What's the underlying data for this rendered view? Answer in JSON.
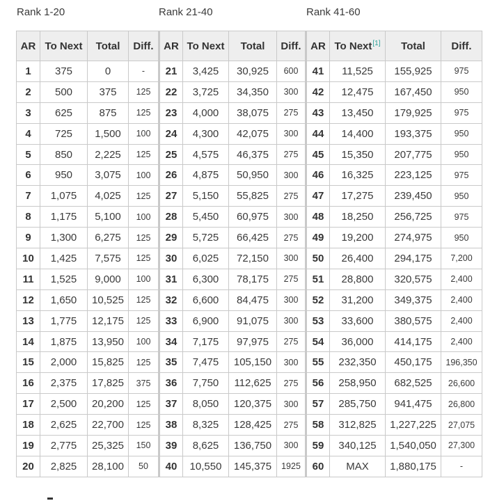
{
  "captions": [
    "Rank 1-20",
    "Rank 21-40",
    "Rank 41-60"
  ],
  "headers": {
    "ar": "AR",
    "to_next": "To Next",
    "total": "Total",
    "diff": "Diff.",
    "footnote_ref": "[1]"
  },
  "rows": [
    [
      [
        "1",
        "375",
        "0",
        "-"
      ],
      [
        "21",
        "3,425",
        "30,925",
        "600"
      ],
      [
        "41",
        "11,525",
        "155,925",
        "975"
      ]
    ],
    [
      [
        "2",
        "500",
        "375",
        "125"
      ],
      [
        "22",
        "3,725",
        "34,350",
        "300"
      ],
      [
        "42",
        "12,475",
        "167,450",
        "950"
      ]
    ],
    [
      [
        "3",
        "625",
        "875",
        "125"
      ],
      [
        "23",
        "4,000",
        "38,075",
        "275"
      ],
      [
        "43",
        "13,450",
        "179,925",
        "975"
      ]
    ],
    [
      [
        "4",
        "725",
        "1,500",
        "100"
      ],
      [
        "24",
        "4,300",
        "42,075",
        "300"
      ],
      [
        "44",
        "14,400",
        "193,375",
        "950"
      ]
    ],
    [
      [
        "5",
        "850",
        "2,225",
        "125"
      ],
      [
        "25",
        "4,575",
        "46,375",
        "275"
      ],
      [
        "45",
        "15,350",
        "207,775",
        "950"
      ]
    ],
    [
      [
        "6",
        "950",
        "3,075",
        "100"
      ],
      [
        "26",
        "4,875",
        "50,950",
        "300"
      ],
      [
        "46",
        "16,325",
        "223,125",
        "975"
      ]
    ],
    [
      [
        "7",
        "1,075",
        "4,025",
        "125"
      ],
      [
        "27",
        "5,150",
        "55,825",
        "275"
      ],
      [
        "47",
        "17,275",
        "239,450",
        "950"
      ]
    ],
    [
      [
        "8",
        "1,175",
        "5,100",
        "100"
      ],
      [
        "28",
        "5,450",
        "60,975",
        "300"
      ],
      [
        "48",
        "18,250",
        "256,725",
        "975"
      ]
    ],
    [
      [
        "9",
        "1,300",
        "6,275",
        "125"
      ],
      [
        "29",
        "5,725",
        "66,425",
        "275"
      ],
      [
        "49",
        "19,200",
        "274,975",
        "950"
      ]
    ],
    [
      [
        "10",
        "1,425",
        "7,575",
        "125"
      ],
      [
        "30",
        "6,025",
        "72,150",
        "300"
      ],
      [
        "50",
        "26,400",
        "294,175",
        "7,200"
      ]
    ],
    [
      [
        "11",
        "1,525",
        "9,000",
        "100"
      ],
      [
        "31",
        "6,300",
        "78,175",
        "275"
      ],
      [
        "51",
        "28,800",
        "320,575",
        "2,400"
      ]
    ],
    [
      [
        "12",
        "1,650",
        "10,525",
        "125"
      ],
      [
        "32",
        "6,600",
        "84,475",
        "300"
      ],
      [
        "52",
        "31,200",
        "349,375",
        "2,400"
      ]
    ],
    [
      [
        "13",
        "1,775",
        "12,175",
        "125"
      ],
      [
        "33",
        "6,900",
        "91,075",
        "300"
      ],
      [
        "53",
        "33,600",
        "380,575",
        "2,400"
      ]
    ],
    [
      [
        "14",
        "1,875",
        "13,950",
        "100"
      ],
      [
        "34",
        "7,175",
        "97,975",
        "275"
      ],
      [
        "54",
        "36,000",
        "414,175",
        "2,400"
      ]
    ],
    [
      [
        "15",
        "2,000",
        "15,825",
        "125"
      ],
      [
        "35",
        "7,475",
        "105,150",
        "300"
      ],
      [
        "55",
        "232,350",
        "450,175",
        "196,350"
      ]
    ],
    [
      [
        "16",
        "2,375",
        "17,825",
        "375"
      ],
      [
        "36",
        "7,750",
        "112,625",
        "275"
      ],
      [
        "56",
        "258,950",
        "682,525",
        "26,600"
      ]
    ],
    [
      [
        "17",
        "2,500",
        "20,200",
        "125"
      ],
      [
        "37",
        "8,050",
        "120,375",
        "300"
      ],
      [
        "57",
        "285,750",
        "941,475",
        "26,800"
      ]
    ],
    [
      [
        "18",
        "2,625",
        "22,700",
        "125"
      ],
      [
        "38",
        "8,325",
        "128,425",
        "275"
      ],
      [
        "58",
        "312,825",
        "1,227,225",
        "27,075"
      ]
    ],
    [
      [
        "19",
        "2,775",
        "25,325",
        "150"
      ],
      [
        "39",
        "8,625",
        "136,750",
        "300"
      ],
      [
        "59",
        "340,125",
        "1,540,050",
        "27,300"
      ]
    ],
    [
      [
        "20",
        "2,825",
        "28,100",
        "50"
      ],
      [
        "40",
        "10,550",
        "145,375",
        "1925"
      ],
      [
        "60",
        "MAX",
        "1,880,175",
        "-"
      ]
    ]
  ]
}
